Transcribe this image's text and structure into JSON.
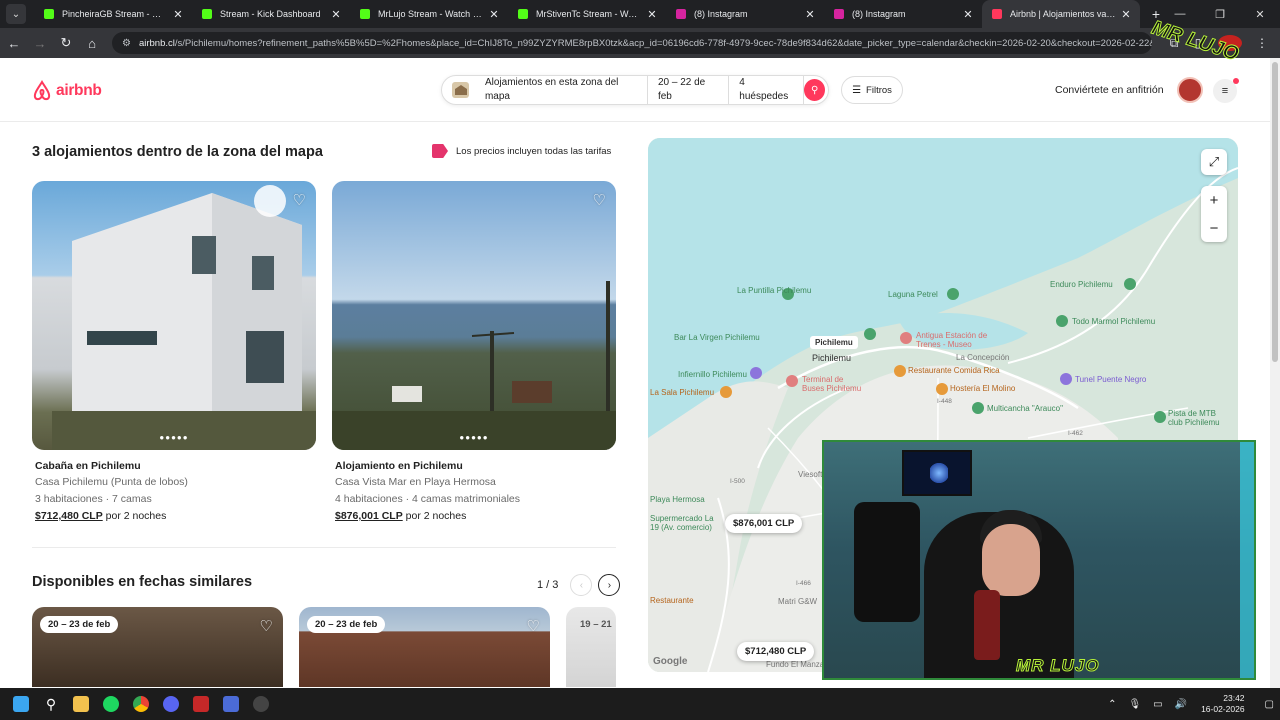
{
  "browser": {
    "tabs": [
      {
        "title": "PincheiraGB Stream - Watch Live",
        "color": "#53fc18"
      },
      {
        "title": "Stream - Kick Dashboard",
        "color": "#53fc18"
      },
      {
        "title": "MrLujo Stream - Watch Live on",
        "color": "#53fc18"
      },
      {
        "title": "MrStivenTc Stream - Watch Live",
        "color": "#53fc18"
      },
      {
        "title": "(8) Instagram",
        "color": "#d6249f"
      },
      {
        "title": "(8) Instagram",
        "color": "#d6249f"
      },
      {
        "title": "Airbnb | Alojamientos vacacion",
        "color": "#ff385c",
        "active": true
      }
    ],
    "url_host": "airbnb.cl",
    "url_path": "/s/Pichilemu/homes?refinement_paths%5B%5D=%2Fhomes&place_id=ChIJ8To_n99ZYZYRME8rpBX0tzk&acp_id=06196cd6-778f-4979-9cec-78de9f834d62&date_picker_type=calendar&checkin=2026-02-20&checkout=2026-02-22&se..."
  },
  "header": {
    "logo": "airbnb",
    "search_location": "Alojamientos en esta zona del mapa",
    "search_dates": "20 – 22 de feb",
    "search_guests": "4 huéspedes",
    "filters_label": "Filtros",
    "host_link": "Conviértete en anfitrión"
  },
  "results": {
    "heading": "3 alojamientos dentro de la zona del mapa",
    "price_note": "Los precios incluyen todas las tarifas",
    "listings": [
      {
        "title": "Cabaña en Pichilemu",
        "name": "Casa Pichilemu (Punta de lobos)",
        "details": "3 habitaciones · 7 camas",
        "price": "$712,480 CLP",
        "price_suffix": "por 2 noches"
      },
      {
        "title": "Alojamiento en Pichilemu",
        "name": "Casa Vista Mar en Playa Hermosa",
        "details": "4 habitaciones · 4 camas matrimoniales",
        "price": "$876,001 CLP",
        "price_suffix": "por 2 noches"
      }
    ]
  },
  "similar": {
    "heading": "Disponibles en fechas similares",
    "page": "1 / 3",
    "dates": [
      "20 – 23 de feb",
      "20 – 23 de feb",
      "19 – 21"
    ]
  },
  "map": {
    "price_pins": [
      "$876,001 CLP",
      "$712,480 CLP"
    ],
    "labels": {
      "la_puntilla": "La Puntilla Pichilemu",
      "laguna_petrel": "Laguna Petrel",
      "enduro": "Enduro Pichilemu",
      "todo_marmol": "Todo Marmol Pichilemu",
      "bar_virgen": "Bar La Virgen Pichilemu",
      "pichilemu_pin": "Pichilemu",
      "pichilemu_town": "Pichilemu",
      "antigua": "Antigua Estación de Trenes - Museo",
      "infiernillo": "Infiernillo Pichilemu",
      "terminal": "Terminal de Buses Pichilemu",
      "restaurante": "Restaurante Comida Rica",
      "tunel": "Tunel Puente Negro",
      "sala_fierro": "La Sala Pichilemu",
      "hosteria": "Hostería El Molino",
      "multicancha": "Multicancha \"Arauco\"",
      "pista": "Pista de MTB club Pichilemu",
      "concepcion": "La Concepción",
      "playa_hermosa": "Playa Hermosa",
      "supermercado": "Supermercado La 19 (Av. comercio)",
      "viesoft": "Viesoft glut",
      "matri": "Matri G&W",
      "fundo": "Fundo El Manzano",
      "restaurante2": "Restaurante",
      "i500": "I-500",
      "i448": "I-448",
      "i466": "I-466",
      "i462": "I-462",
      "google": "Google"
    }
  },
  "overlay": {
    "cam_logo": "MR LUJO",
    "corner_logo": "MR LUJO"
  },
  "taskbar": {
    "time": "23:42",
    "date": "16-02-2026"
  }
}
